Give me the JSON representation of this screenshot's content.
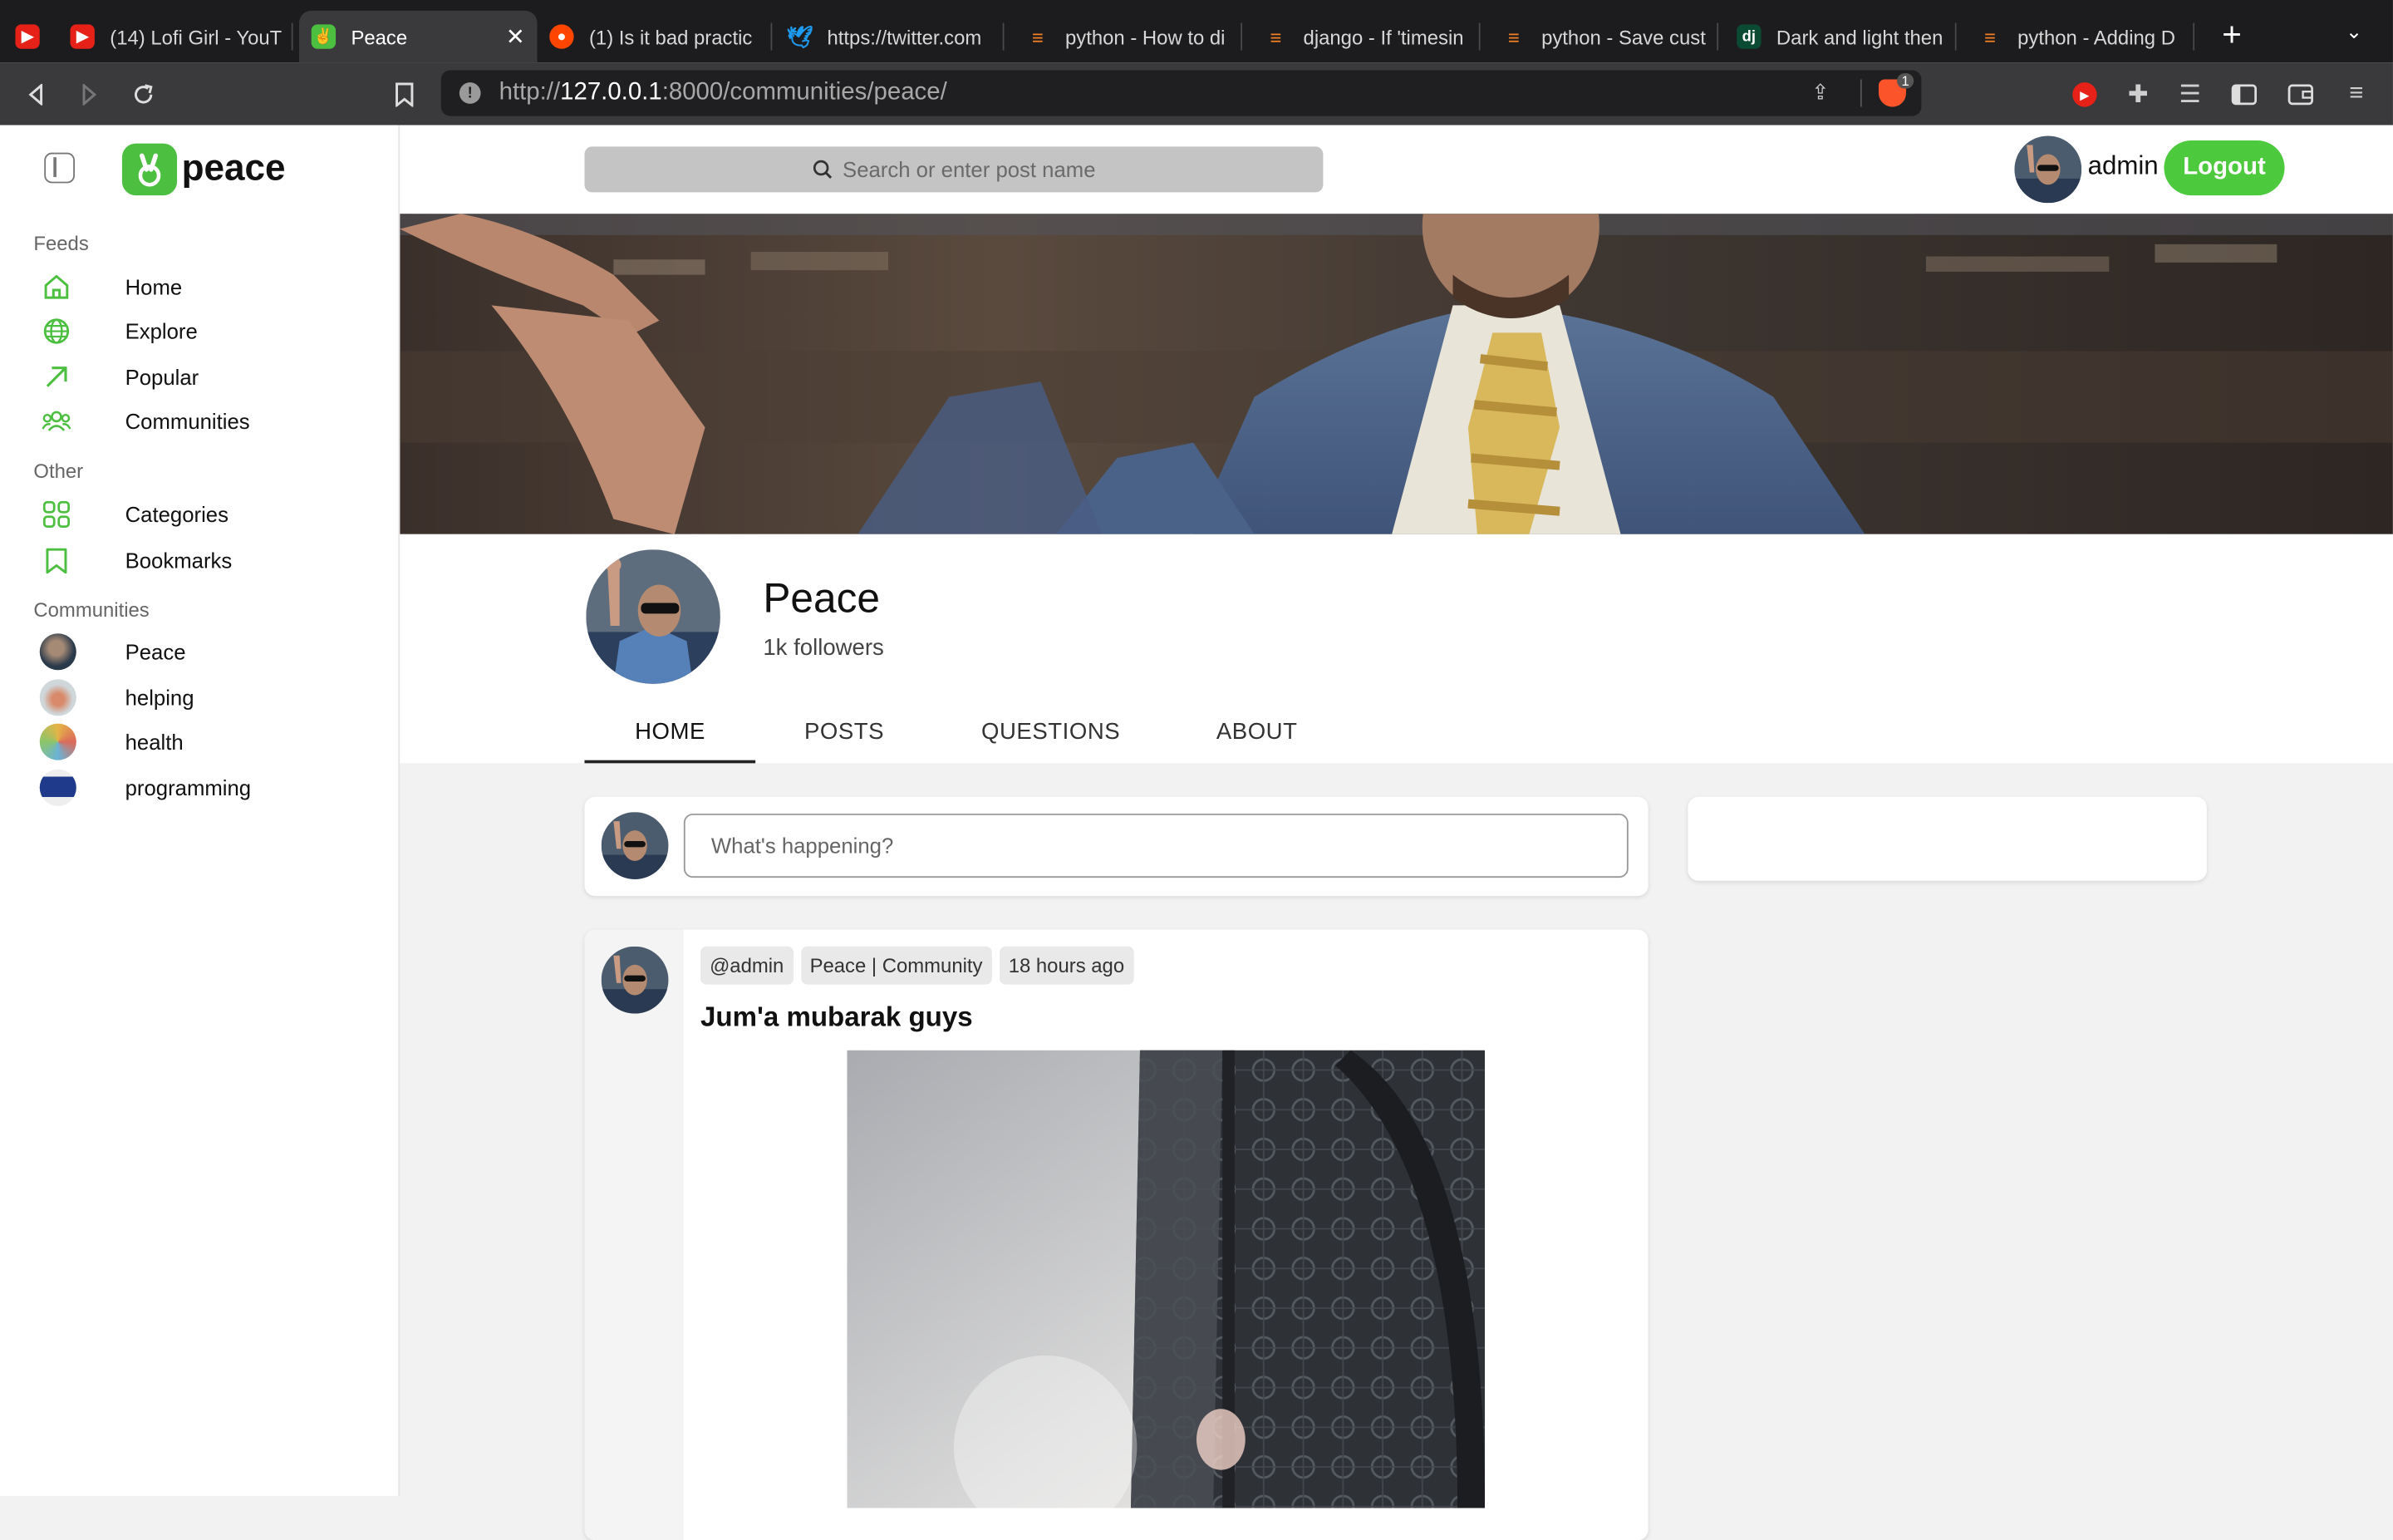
{
  "browser": {
    "tabs": [
      {
        "title": "",
        "icon": "youtube-icon",
        "color": "#e62117"
      },
      {
        "title": "(14) Lofi Girl - YouT",
        "icon": "youtube-icon",
        "color": "#e62117"
      },
      {
        "title": "Peace",
        "icon": "peace-icon",
        "color": "#4cbf40"
      },
      {
        "title": "(1) Is it bad practic",
        "icon": "reddit-icon",
        "color": "#ff4500"
      },
      {
        "title": "https://twitter.com",
        "icon": "twitter-icon",
        "color": "#1d9bf0"
      },
      {
        "title": "python - How to di",
        "icon": "stackoverflow-icon",
        "color": "#f48024"
      },
      {
        "title": "django - If 'timesin",
        "icon": "stackoverflow-icon",
        "color": "#f48024"
      },
      {
        "title": "python - Save cust",
        "icon": "stackoverflow-icon",
        "color": "#f48024"
      },
      {
        "title": "Dark and light then",
        "icon": "django-icon",
        "color": "#0c4b33"
      },
      {
        "title": "python - Adding D",
        "icon": "stackoverflow-icon",
        "color": "#f48024"
      }
    ],
    "url_prefix": "http://",
    "url_host": "127.0.0.1",
    "url_rest": ":8000/communities/peace/",
    "shield_count": "1"
  },
  "app": {
    "brand": "peace",
    "search_placeholder": "Search or enter post name",
    "user": "admin",
    "logout": "Logout",
    "accent": "#4cc93c"
  },
  "sidebar": {
    "feeds_title": "Feeds",
    "feeds": [
      {
        "label": "Home",
        "icon": "home-icon"
      },
      {
        "label": "Explore",
        "icon": "globe-icon"
      },
      {
        "label": "Popular",
        "icon": "arrow-up-right-icon"
      },
      {
        "label": "Communities",
        "icon": "users-icon"
      }
    ],
    "other_title": "Other",
    "other": [
      {
        "label": "Categories",
        "icon": "grid-icon"
      },
      {
        "label": "Bookmarks",
        "icon": "bookmark-icon"
      }
    ],
    "communities_title": "Communities",
    "communities": [
      {
        "label": "Peace"
      },
      {
        "label": "helping"
      },
      {
        "label": "health"
      },
      {
        "label": "programming"
      }
    ]
  },
  "community": {
    "name": "Peace",
    "followers": "1k followers",
    "tabs": [
      "HOME",
      "POSTS",
      "QUESTIONS",
      "ABOUT"
    ]
  },
  "compose": {
    "placeholder": "What's happening?"
  },
  "post": {
    "author": "@admin",
    "community": "Peace | Community",
    "time": "18 hours ago",
    "title": "Jum'a mubarak guys"
  }
}
